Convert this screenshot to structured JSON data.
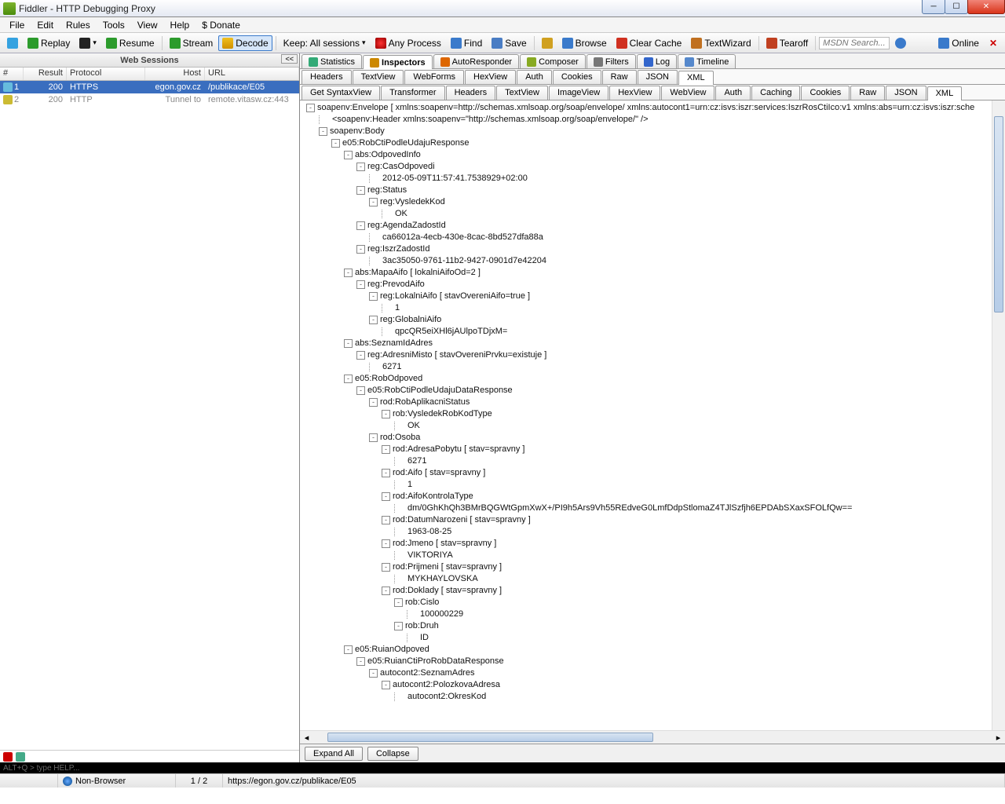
{
  "window": {
    "title": "Fiddler - HTTP Debugging Proxy"
  },
  "menu": [
    "File",
    "Edit",
    "Rules",
    "Tools",
    "View",
    "Help",
    "$ Donate"
  ],
  "toolbar": {
    "replay": "Replay",
    "resume": "Resume",
    "stream": "Stream",
    "decode": "Decode",
    "keep": "Keep: All sessions",
    "anyproc": "Any Process",
    "find": "Find",
    "save": "Save",
    "browse": "Browse",
    "clear": "Clear Cache",
    "textw": "TextWizard",
    "tearoff": "Tearoff",
    "search_ph": "MSDN Search...",
    "online": "Online"
  },
  "sessions": {
    "title": "Web Sessions",
    "collapse": "<<",
    "columns": {
      "num": "#",
      "result": "Result",
      "protocol": "Protocol",
      "host": "Host",
      "url": "URL"
    },
    "rows": [
      {
        "num": "1",
        "result": "200",
        "protocol": "HTTPS",
        "host": "egon.gov.cz",
        "url": "/publikace/E05",
        "selected": true
      },
      {
        "num": "2",
        "result": "200",
        "protocol": "HTTP",
        "host": "Tunnel to",
        "url": "remote.vitasw.cz:443",
        "dim": true
      }
    ]
  },
  "tabs_main": [
    "Statistics",
    "Inspectors",
    "AutoResponder",
    "Composer",
    "Filters",
    "Log",
    "Timeline"
  ],
  "tabs_main_active": "Inspectors",
  "tabs_req": [
    "Headers",
    "TextView",
    "WebForms",
    "HexView",
    "Auth",
    "Cookies",
    "Raw",
    "JSON",
    "XML"
  ],
  "tabs_req_active": "XML",
  "tabs_resp": [
    "Get SyntaxView",
    "Transformer",
    "Headers",
    "TextView",
    "ImageView",
    "HexView",
    "WebView",
    "Auth",
    "Caching",
    "Cookies",
    "Raw",
    "JSON",
    "XML"
  ],
  "tabs_resp_active": "XML",
  "xml_lines": [
    [
      0,
      "-",
      "soapenv:Envelope [ xmlns:soapenv=http://schemas.xmlsoap.org/soap/envelope/ xmlns:autocont1=urn:cz:isvs:iszr:services:IszrRosCtiIco:v1 xmlns:abs=urn:cz:isvs:iszr:sche"
    ],
    [
      1,
      "",
      "<soapenv:Header xmlns:soapenv=\"http://schemas.xmlsoap.org/soap/envelope/\" />"
    ],
    [
      1,
      "-",
      "soapenv:Body"
    ],
    [
      2,
      "-",
      "e05:RobCtiPodleUdajuResponse"
    ],
    [
      3,
      "-",
      "abs:OdpovedInfo"
    ],
    [
      4,
      "-",
      "reg:CasOdpovedi"
    ],
    [
      5,
      "",
      "2012-05-09T11:57:41.7538929+02:00"
    ],
    [
      4,
      "-",
      "reg:Status"
    ],
    [
      5,
      "-",
      "reg:VysledekKod"
    ],
    [
      6,
      "",
      "OK"
    ],
    [
      4,
      "-",
      "reg:AgendaZadostId"
    ],
    [
      5,
      "",
      "ca66012a-4ecb-430e-8cac-8bd527dfa88a"
    ],
    [
      4,
      "-",
      "reg:IszrZadostId"
    ],
    [
      5,
      "",
      "3ac35050-9761-11b2-9427-0901d7e42204"
    ],
    [
      3,
      "-",
      "abs:MapaAifo [ lokalniAifoOd=2 ]"
    ],
    [
      4,
      "-",
      "reg:PrevodAifo"
    ],
    [
      5,
      "-",
      "reg:LokalniAifo [ stavOvereniAifo=true ]"
    ],
    [
      6,
      "",
      "1"
    ],
    [
      5,
      "-",
      "reg:GlobalniAifo"
    ],
    [
      6,
      "",
      "qpcQR5eiXHl6jAUlpoTDjxM="
    ],
    [
      3,
      "-",
      "abs:SeznamIdAdres"
    ],
    [
      4,
      "-",
      "reg:AdresniMisto [ stavOvereniPrvku=existuje ]"
    ],
    [
      5,
      "",
      "6271"
    ],
    [
      3,
      "-",
      "e05:RobOdpoved"
    ],
    [
      4,
      "-",
      "e05:RobCtiPodleUdajuDataResponse"
    ],
    [
      5,
      "-",
      "rod:RobAplikacniStatus"
    ],
    [
      6,
      "-",
      "rob:VysledekRobKodType"
    ],
    [
      7,
      "",
      "OK"
    ],
    [
      5,
      "-",
      "rod:Osoba"
    ],
    [
      6,
      "-",
      "rod:AdresaPobytu [ stav=spravny ]"
    ],
    [
      7,
      "",
      "6271"
    ],
    [
      6,
      "-",
      "rod:Aifo [ stav=spravny ]"
    ],
    [
      7,
      "",
      "1"
    ],
    [
      6,
      "-",
      "rod:AifoKontrolaType"
    ],
    [
      7,
      "",
      "dm/0GhKhQh3BMrBQGWtGpmXwX+/PI9h5Ars9Vh55REdveG0LmfDdpStlomaZ4TJlSzfjh6EPDAbSXaxSFOLfQw=="
    ],
    [
      6,
      "-",
      "rod:DatumNarozeni [ stav=spravny ]"
    ],
    [
      7,
      "",
      "1963-08-25"
    ],
    [
      6,
      "-",
      "rod:Jmeno [ stav=spravny ]"
    ],
    [
      7,
      "",
      "VIKTORIYA"
    ],
    [
      6,
      "-",
      "rod:Prijmeni [ stav=spravny ]"
    ],
    [
      7,
      "",
      "MYKHAYLOVSKA"
    ],
    [
      6,
      "-",
      "rod:Doklady [ stav=spravny ]"
    ],
    [
      7,
      "-",
      "rob:Cislo"
    ],
    [
      8,
      "",
      "100000229"
    ],
    [
      7,
      "-",
      "rob:Druh"
    ],
    [
      8,
      "",
      "ID"
    ],
    [
      3,
      "-",
      "e05:RuianOdpoved"
    ],
    [
      4,
      "-",
      "e05:RuianCtiProRobDataResponse"
    ],
    [
      5,
      "-",
      "autocont2:SeznamAdres"
    ],
    [
      6,
      "-",
      "autocont2:PolozkovaAdresa"
    ],
    [
      7,
      "",
      "autocont2:OkresKod"
    ]
  ],
  "footer": {
    "expand": "Expand All",
    "collapse": "Collapse"
  },
  "quickexec": "ALT+Q > type HELP...",
  "status": {
    "capture": "",
    "browser": "Non-Browser",
    "count": "1 / 2",
    "url": "https://egon.gov.cz/publikace/E05"
  }
}
